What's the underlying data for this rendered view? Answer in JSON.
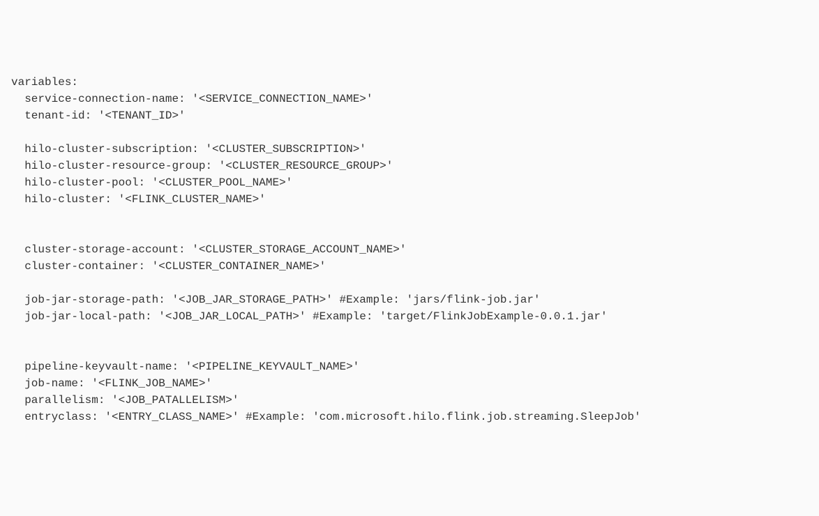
{
  "code": {
    "header": "variables:",
    "lines": [
      {
        "key": "service-connection-name",
        "value": "'<SERVICE_CONNECTION_NAME>'",
        "comment": ""
      },
      {
        "key": "tenant-id",
        "value": "'<TENANT_ID>'",
        "comment": ""
      },
      {
        "blank": true
      },
      {
        "key": "hilo-cluster-subscription",
        "value": "'<CLUSTER_SUBSCRIPTION>'",
        "comment": ""
      },
      {
        "key": "hilo-cluster-resource-group",
        "value": "'<CLUSTER_RESOURCE_GROUP>'",
        "comment": ""
      },
      {
        "key": "hilo-cluster-pool",
        "value": "'<CLUSTER_POOL_NAME>'",
        "comment": ""
      },
      {
        "key": "hilo-cluster",
        "value": "'<FLINK_CLUSTER_NAME>'",
        "comment": ""
      },
      {
        "blank": true
      },
      {
        "blank": true
      },
      {
        "key": "cluster-storage-account",
        "value": "'<CLUSTER_STORAGE_ACCOUNT_NAME>'",
        "comment": ""
      },
      {
        "key": "cluster-container",
        "value": "'<CLUSTER_CONTAINER_NAME>'",
        "comment": ""
      },
      {
        "blank": true
      },
      {
        "key": "job-jar-storage-path",
        "value": "'<JOB_JAR_STORAGE_PATH>'",
        "comment": " #Example: 'jars/flink-job.jar'"
      },
      {
        "key": "job-jar-local-path",
        "value": "'<JOB_JAR_LOCAL_PATH>'",
        "comment": " #Example: 'target/FlinkJobExample-0.0.1.jar'"
      },
      {
        "blank": true
      },
      {
        "blank": true
      },
      {
        "key": "pipeline-keyvault-name",
        "value": "'<PIPELINE_KEYVAULT_NAME>'",
        "comment": ""
      },
      {
        "key": "job-name",
        "value": "'<FLINK_JOB_NAME>'",
        "comment": ""
      },
      {
        "key": "parallelism",
        "value": "'<JOB_PATALLELISM>'",
        "comment": ""
      },
      {
        "key": "entryclass",
        "value": "'<ENTRY_CLASS_NAME>'",
        "comment": " #Example: 'com.microsoft.hilo.flink.job.streaming.SleepJob'"
      }
    ]
  }
}
